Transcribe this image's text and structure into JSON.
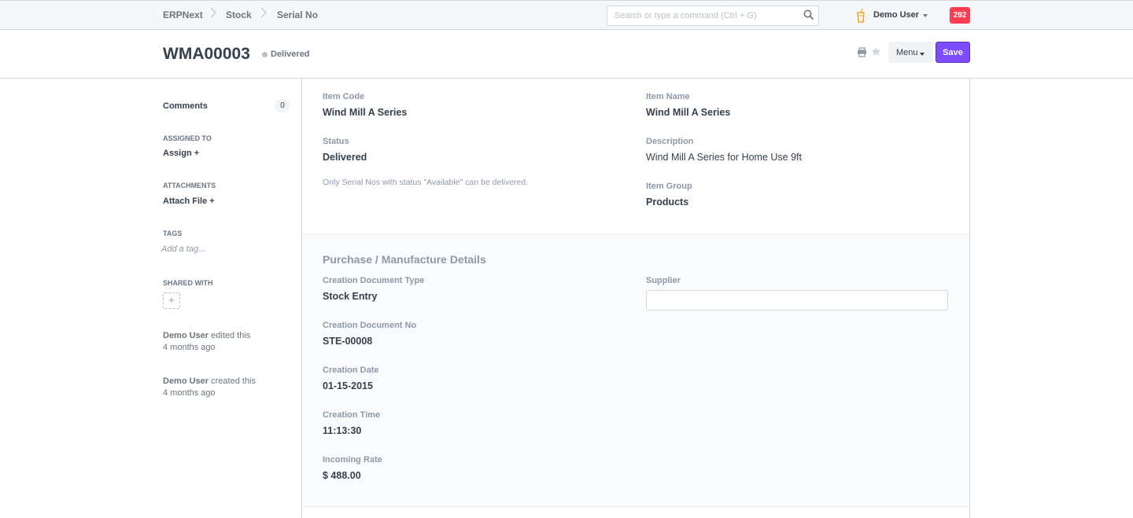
{
  "navbar": {
    "breadcrumbs": [
      "ERPNext",
      "Stock",
      "Serial No"
    ],
    "search_placeholder": "Search or type a command (Ctrl + G)",
    "user_name": "Demo User",
    "notification_count": "292"
  },
  "page": {
    "title": "WMA00003",
    "status": "Delivered",
    "menu_label": "Menu",
    "save_label": "Save"
  },
  "sidebar": {
    "comments_label": "Comments",
    "comments_count": "0",
    "assigned_to_heading": "ASSIGNED TO",
    "assign_label": "Assign +",
    "attachments_heading": "ATTACHMENTS",
    "attach_label": "Attach File +",
    "tags_heading": "TAGS",
    "tag_placeholder": "Add a tag...",
    "shared_with_heading": "SHARED WITH",
    "shared_add": "+",
    "timeline": [
      {
        "user": "Demo User",
        "action": "edited this",
        "time": "4 months ago"
      },
      {
        "user": "Demo User",
        "action": "created this",
        "time": "4 months ago"
      }
    ]
  },
  "form": {
    "item_code_label": "Item Code",
    "item_code": "Wind Mill A Series",
    "item_name_label": "Item Name",
    "item_name": "Wind Mill A Series",
    "status_label": "Status",
    "status": "Delivered",
    "status_help": "Only Serial Nos with status \"Available\" can be delivered.",
    "description_label": "Description",
    "description": "Wind Mill A Series for Home Use 9ft",
    "item_group_label": "Item Group",
    "item_group": "Products",
    "section_title": "Purchase / Manufacture Details",
    "creation_doc_type_label": "Creation Document Type",
    "creation_doc_type": "Stock Entry",
    "supplier_label": "Supplier",
    "supplier": "",
    "creation_doc_no_label": "Creation Document No",
    "creation_doc_no": "STE-00008",
    "creation_date_label": "Creation Date",
    "creation_date": "01-15-2015",
    "creation_time_label": "Creation Time",
    "creation_time": "11:13:30",
    "incoming_rate_label": "Incoming Rate",
    "incoming_rate": "$ 488.00"
  }
}
